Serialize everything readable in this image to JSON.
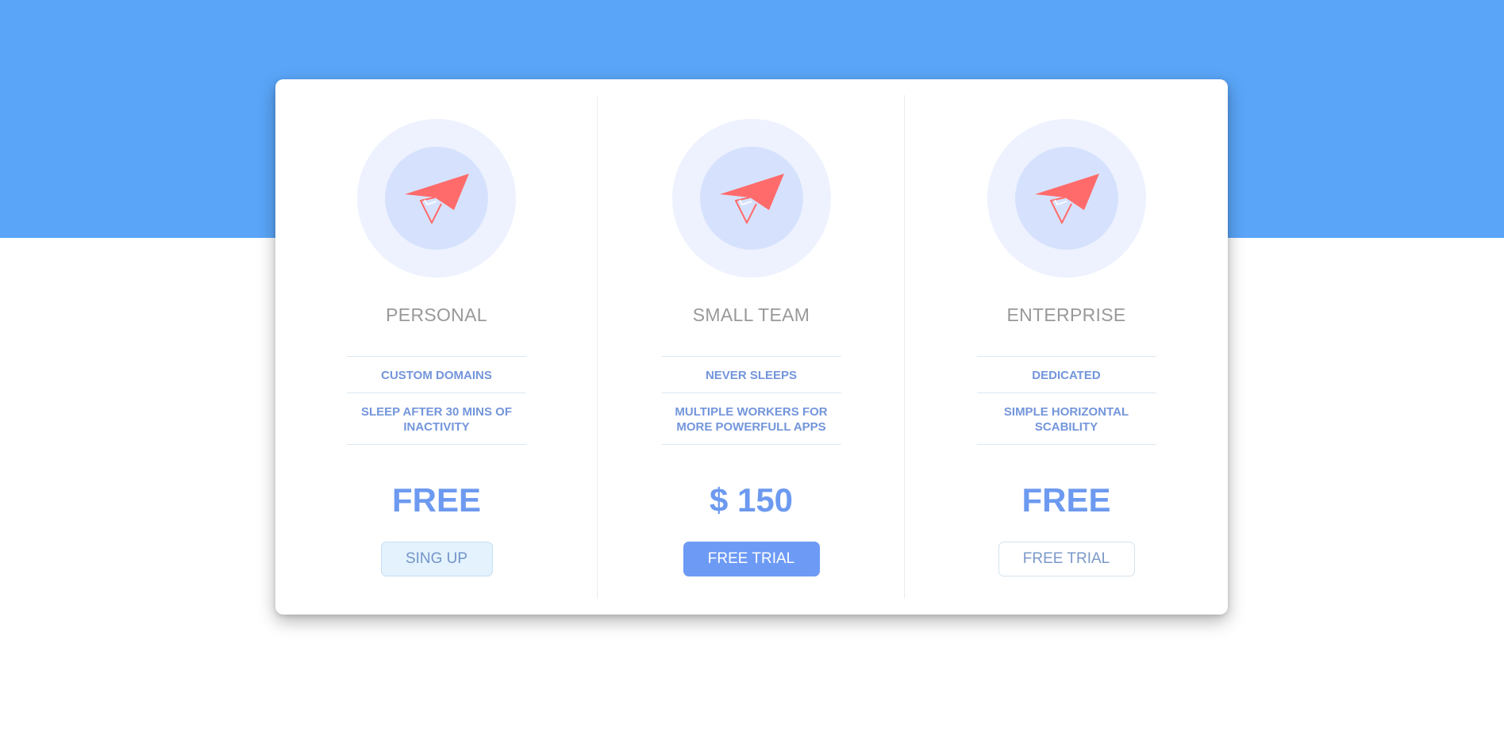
{
  "colors": {
    "hero_band": "#5aa5f8",
    "accent": "#6d9af0",
    "plane": "#ff6b6b",
    "feature_text": "#7395db",
    "plan_name_text": "#999999"
  },
  "plans": [
    {
      "name": "PERSONAL",
      "icon": "paper-plane-icon",
      "features": [
        "CUSTOM DOMAINS",
        "SLEEP AFTER 30 MINS OF INACTIVITY"
      ],
      "price": "FREE",
      "button_label": "SING UP"
    },
    {
      "name": "SMALL TEAM",
      "icon": "paper-plane-icon",
      "features": [
        "NEVER SLEEPS",
        "MULTIPLE WORKERS FOR MORE POWERFULL APPS"
      ],
      "price": "$ 150",
      "button_label": "FREE TRIAL"
    },
    {
      "name": "ENTERPRISE",
      "icon": "paper-plane-icon",
      "features": [
        "DEDICATED",
        "SIMPLE HORIZONTAL SCABILITY"
      ],
      "price": "FREE",
      "button_label": "FREE TRIAL"
    }
  ]
}
